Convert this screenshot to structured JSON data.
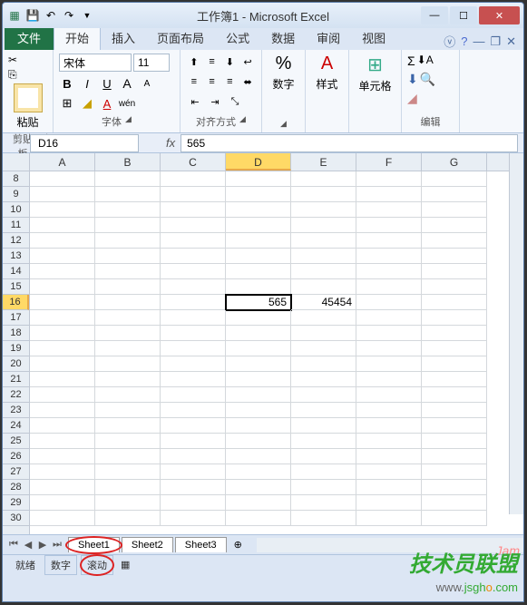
{
  "title": "工作簿1 - Microsoft Excel",
  "tabs": {
    "file": "文件",
    "home": "开始",
    "insert": "插入",
    "layout": "页面布局",
    "formulas": "公式",
    "data": "数据",
    "review": "审阅",
    "view": "视图"
  },
  "ribbon": {
    "clipboard": {
      "label": "剪贴板",
      "paste": "粘贴"
    },
    "font": {
      "label": "字体",
      "name": "宋体",
      "size": "11",
      "bold": "B",
      "italic": "I",
      "underline": "U"
    },
    "align": {
      "label": "对齐方式"
    },
    "number": {
      "label": "数字",
      "pct": "%"
    },
    "styles": {
      "label": "样式"
    },
    "cells": {
      "label": "单元格"
    },
    "edit": {
      "label": "编辑",
      "sigma": "Σ"
    }
  },
  "namebox": "D16",
  "fx": "fx",
  "formula": "565",
  "columns": [
    "A",
    "B",
    "C",
    "D",
    "E",
    "F",
    "G"
  ],
  "selected_col": "D",
  "rows": [
    8,
    9,
    10,
    11,
    12,
    13,
    14,
    15,
    16,
    17,
    18,
    19,
    20,
    21,
    22,
    23,
    24,
    25,
    26,
    27,
    28,
    29,
    30
  ],
  "selected_row": 16,
  "cells": {
    "D16": "565",
    "E16": "45454"
  },
  "sheets": {
    "s1": "Sheet1",
    "s2": "Sheet2",
    "s3": "Sheet3"
  },
  "status": {
    "ready": "就绪",
    "num": "数字",
    "scroll": "滚动"
  },
  "watermark": "技术员联盟",
  "watermark_url_pre": "www.",
  "watermark_url_mid": "jsgh",
  "watermark_url_o": "o",
  "watermark_url_suf": ".com",
  "jam": "Jam"
}
